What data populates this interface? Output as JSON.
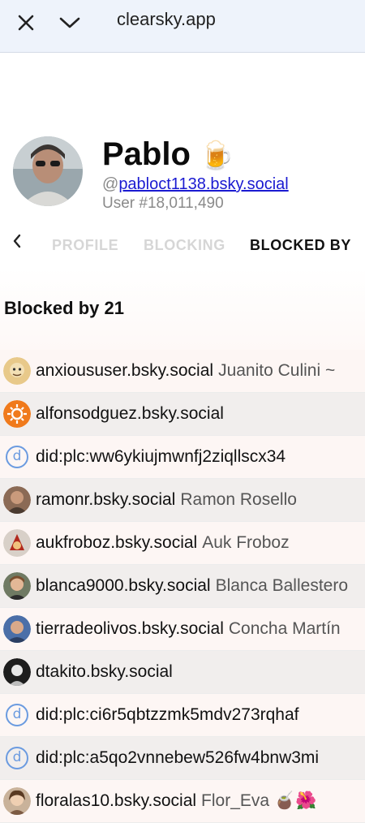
{
  "browser": {
    "url": "clearsky.app"
  },
  "profile": {
    "name": "Pablo",
    "emoji": "🍺",
    "handle_prefix": "@",
    "handle": "pabloct1138.bsky.social",
    "user_number": "User #18,011,490"
  },
  "tabs": [
    {
      "label": "PROFILE",
      "active": false
    },
    {
      "label": "BLOCKING",
      "active": false
    },
    {
      "label": "BLOCKED BY",
      "active": true
    }
  ],
  "section": {
    "title": "Blocked by 21"
  },
  "blockers": [
    {
      "handle": "anxioususer.bsky.social",
      "display_name": "Juanito Culini ~",
      "avatar": "cartoon-avatar"
    },
    {
      "handle": "alfonsodguez.bsky.social",
      "display_name": "",
      "avatar": "orange-avatar"
    },
    {
      "handle": "did:plc:ww6ykiujmwnfj2ziqllscx34",
      "display_name": "",
      "avatar": "did-icon"
    },
    {
      "handle": "ramonr.bsky.social",
      "display_name": "Ramon Rosello",
      "avatar": "photo-avatar"
    },
    {
      "handle": "aukfroboz.bsky.social",
      "display_name": "Auk Froboz",
      "avatar": "photo-avatar"
    },
    {
      "handle": "blanca9000.bsky.social",
      "display_name": "Blanca Ballestero",
      "avatar": "photo-avatar"
    },
    {
      "handle": "tierradeolivos.bsky.social",
      "display_name": "Concha Martín",
      "avatar": "photo-avatar"
    },
    {
      "handle": "dtakito.bsky.social",
      "display_name": "",
      "avatar": "dark-avatar"
    },
    {
      "handle": "did:plc:ci6r5qbtzzmk5mdv273rqhaf",
      "display_name": "",
      "avatar": "did-icon"
    },
    {
      "handle": "did:plc:a5qo2vnnebew526fw4bnw3mi",
      "display_name": "",
      "avatar": "did-icon"
    },
    {
      "handle": "floralas10.bsky.social",
      "display_name": "Flor_Eva 🧉🌺",
      "avatar": "photo-avatar"
    }
  ],
  "colors": {
    "topbar_bg": "#eef3fb",
    "link": "#1a1ad1",
    "inactive_tab": "#d6d6d6",
    "row_alt": "#f1eeed",
    "row_base": "#fdf6f4",
    "did_icon": "#6b9be0"
  }
}
